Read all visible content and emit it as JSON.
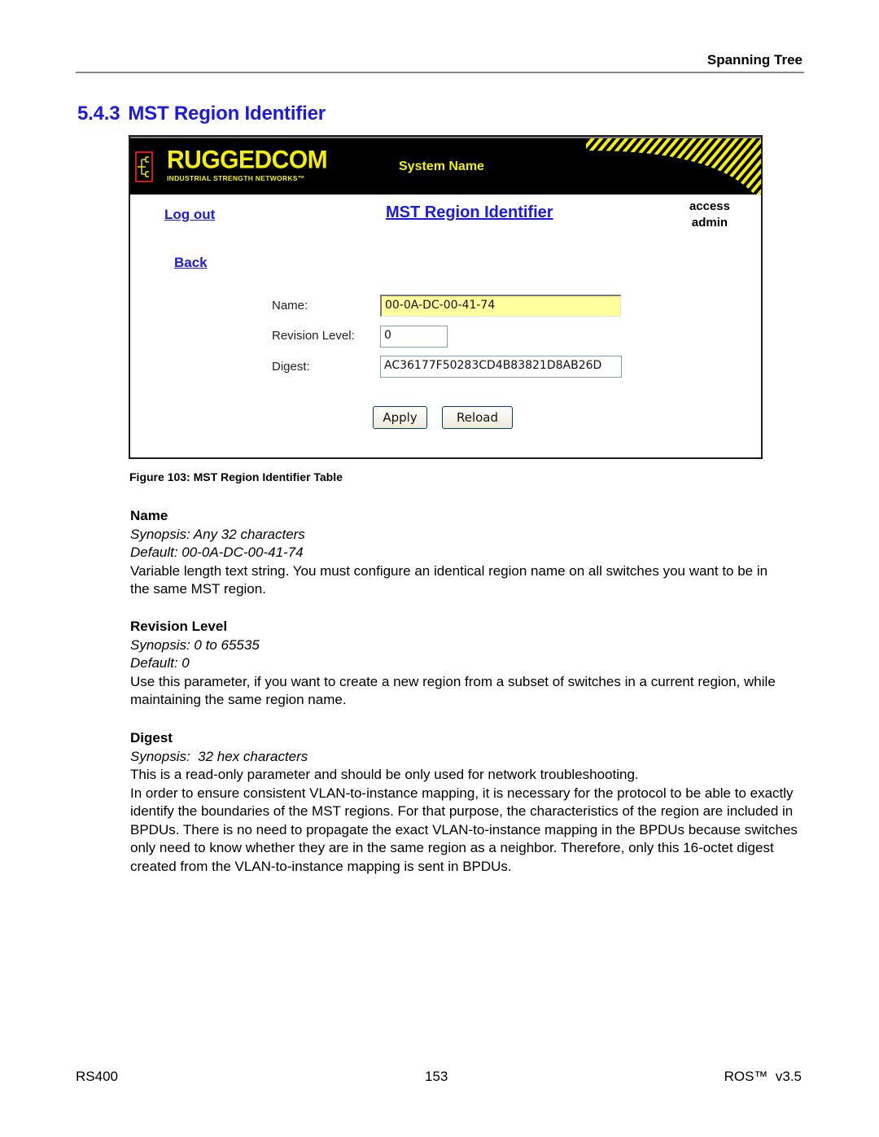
{
  "running_head": "Spanning Tree",
  "section": {
    "number": "5.4.3",
    "title": "MST Region Identifier"
  },
  "screen": {
    "banner": {
      "logo_text": "RUGGEDCOM",
      "logo_tagline": "INDUSTRIAL STRENGTH NETWORKS™",
      "system_name": "System Name",
      "colors": {
        "background": "#000000",
        "accent": "#f5f000",
        "logo_border": "#cc1a1a"
      }
    },
    "nav": {
      "logout": "Log out",
      "back": "Back"
    },
    "page_heading": "MST Region Identifier",
    "access_label": "access",
    "access_user": "admin",
    "form": {
      "fields": [
        {
          "label": "Name:",
          "value": "00-0A-DC-00-41-74",
          "highlighted": true
        },
        {
          "label": "Revision Level:",
          "value": "0"
        },
        {
          "label": "Digest:",
          "value": "AC36177F50283CD4B83821D8AB26D"
        }
      ],
      "apply_label": "Apply",
      "reload_label": "Reload"
    }
  },
  "figure_caption": "Figure 103: MST Region Identifier Table",
  "params": [
    {
      "name": "Name",
      "synopsis": "Synopsis: Any 32 characters",
      "default": "Default: 00-0A-DC-00-41-74",
      "description": "Variable length text string. You must configure an identical region name on all switches you want to be in the same MST region."
    },
    {
      "name": "Revision Level",
      "synopsis": "Synopsis: 0 to 65535",
      "default": "Default: 0",
      "description": "Use this parameter, if you want to create a new region from a subset of switches in a current region, while maintaining the same region name."
    },
    {
      "name": "Digest",
      "synopsis": "Synopsis:  32 hex characters",
      "description": "This is a read-only parameter and should be only used for network troubleshooting.",
      "description2": "In order to ensure consistent VLAN-to-instance mapping, it is necessary for the protocol to be able to exactly identify the boundaries of the MST regions. For that purpose, the characteristics of the region are included in BPDUs. There is no need to propagate the exact VLAN-to-instance mapping in the BPDUs because switches only need to know whether they are in the same region as a neighbor. Therefore, only this 16-octet digest created from the VLAN-to-instance mapping is sent in BPDUs."
    }
  ],
  "footer": {
    "left": "RS400",
    "center": "153",
    "right": "ROS™  v3.5"
  }
}
